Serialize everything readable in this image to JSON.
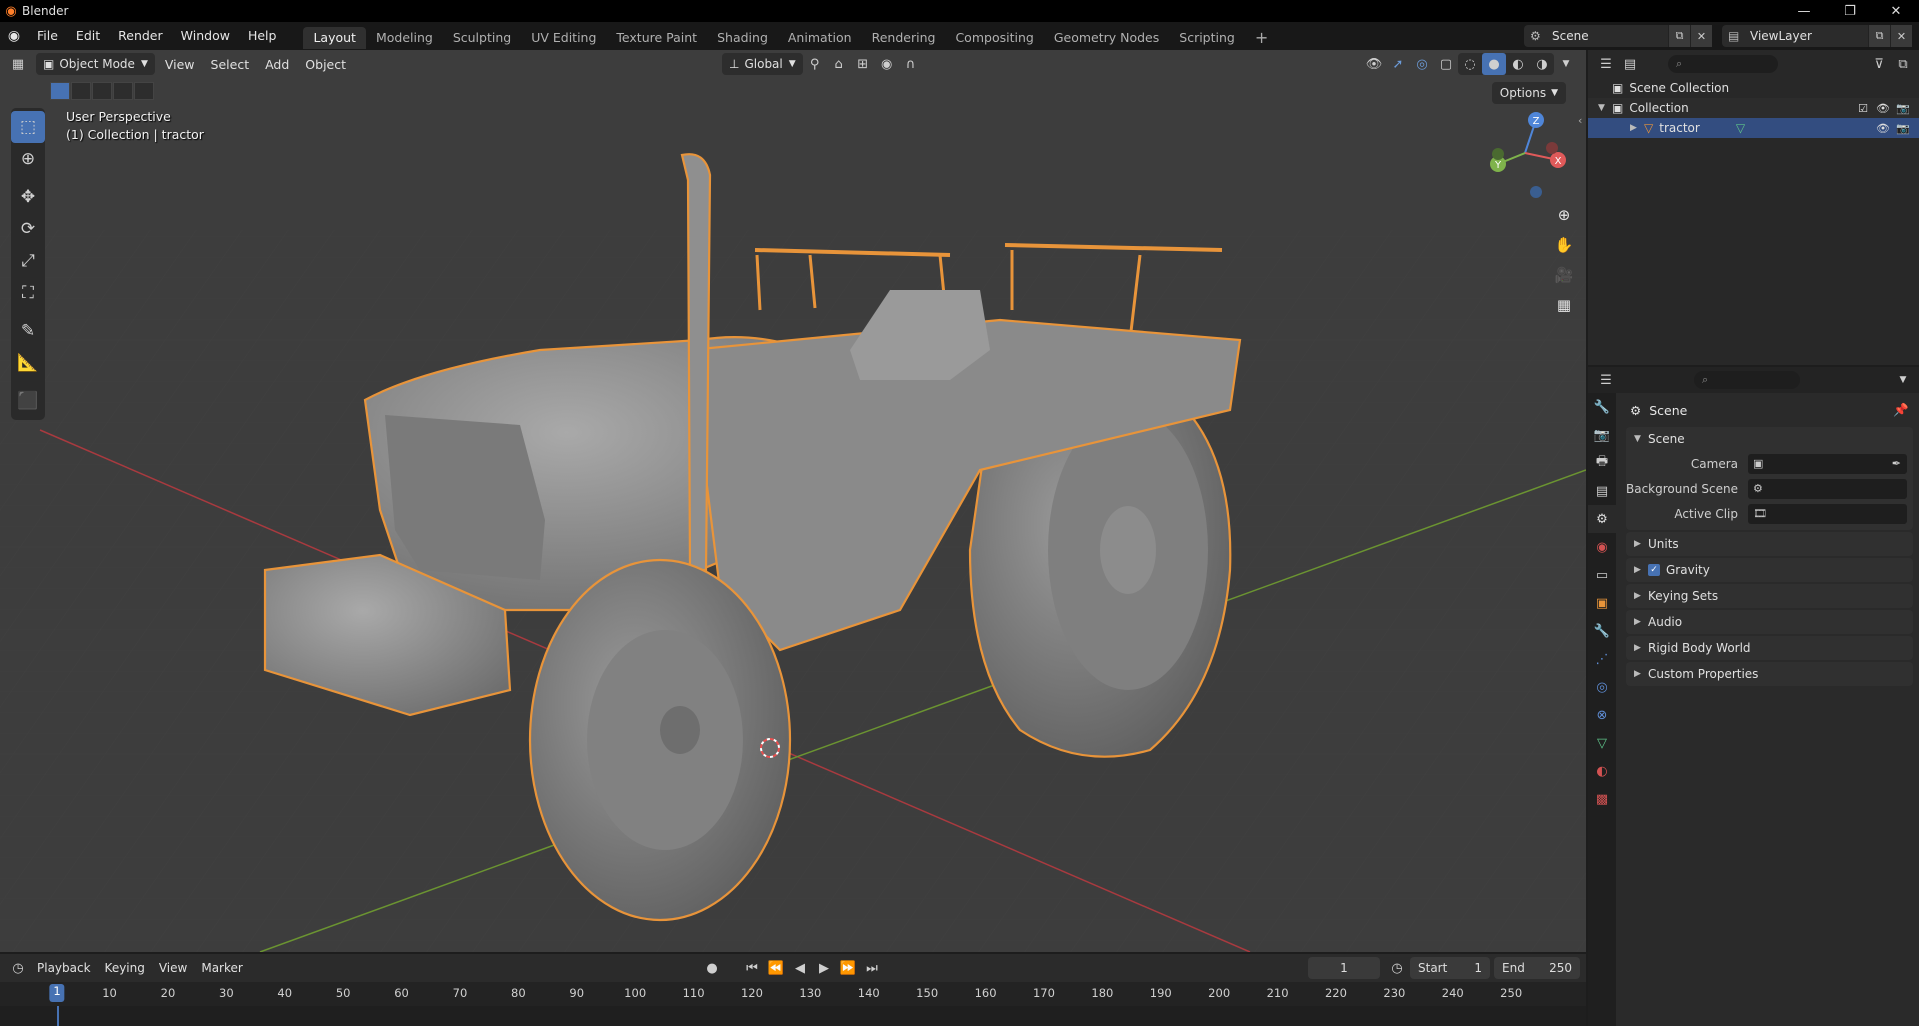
{
  "window": {
    "title": "Blender",
    "controls": [
      "—",
      "❐",
      "✕"
    ]
  },
  "menu": [
    "File",
    "Edit",
    "Render",
    "Window",
    "Help"
  ],
  "workspaces": [
    {
      "label": "Layout",
      "active": true
    },
    {
      "label": "Modeling"
    },
    {
      "label": "Sculpting"
    },
    {
      "label": "UV Editing"
    },
    {
      "label": "Texture Paint"
    },
    {
      "label": "Shading"
    },
    {
      "label": "Animation"
    },
    {
      "label": "Rendering"
    },
    {
      "label": "Compositing"
    },
    {
      "label": "Geometry Nodes"
    },
    {
      "label": "Scripting"
    }
  ],
  "scene_selector": {
    "value": "Scene"
  },
  "viewlayer_selector": {
    "value": "ViewLayer"
  },
  "viewport": {
    "mode": "Object Mode",
    "menus": [
      "View",
      "Select",
      "Add",
      "Object"
    ],
    "transform_orientation": "Global",
    "options_label": "Options",
    "info_line1": "User Perspective",
    "info_line2": "(1) Collection | tractor",
    "gizmo_labels": {
      "z": "Z",
      "y": "Y",
      "x": "X"
    }
  },
  "outliner": {
    "items": [
      {
        "label": "Scene Collection"
      },
      {
        "label": "Collection"
      },
      {
        "label": "tractor",
        "selected": true
      }
    ]
  },
  "properties": {
    "context": "Scene",
    "scene_panel": {
      "title": "Scene",
      "rows": [
        {
          "label": "Camera",
          "value": ""
        },
        {
          "label": "Background Scene",
          "value": ""
        },
        {
          "label": "Active Clip",
          "value": ""
        }
      ]
    },
    "collapsed_panels": [
      "Units",
      "Gravity",
      "Keying Sets",
      "Audio",
      "Rigid Body World",
      "Custom Properties"
    ]
  },
  "timeline": {
    "menus": [
      "Playback",
      "Keying",
      "View",
      "Marker"
    ],
    "current_frame": "1",
    "start_label": "Start",
    "start": "1",
    "end_label": "End",
    "end": "250",
    "ruler_ticks": [
      "10",
      "20",
      "30",
      "40",
      "50",
      "60",
      "70",
      "80",
      "90",
      "100",
      "110",
      "120",
      "130",
      "140",
      "150",
      "160",
      "170",
      "180",
      "190",
      "200",
      "210",
      "220",
      "230",
      "240",
      "250"
    ]
  },
  "colors": {
    "accent": "#4772b3",
    "selection_outline": "#e8943a",
    "axis_x": "#a83a3f",
    "axis_y": "#6b9431"
  }
}
